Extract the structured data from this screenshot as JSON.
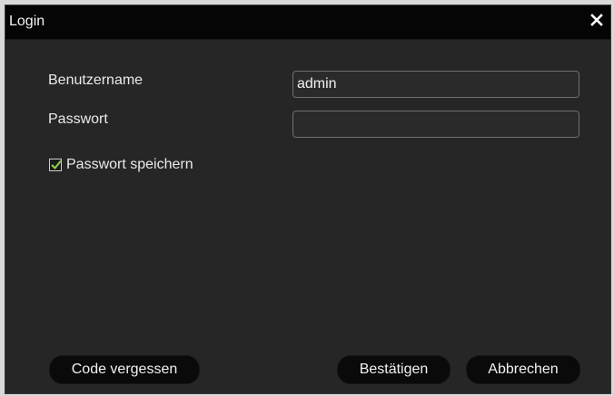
{
  "window": {
    "title": "Login",
    "close_icon": "close-icon"
  },
  "form": {
    "username_label": "Benutzername",
    "username_value": "admin",
    "password_label": "Passwort",
    "password_value": "",
    "remember_label": "Passwort speichern",
    "remember_checked": true
  },
  "buttons": {
    "forgot_label": "Code vergessen",
    "confirm_label": "Bestätigen",
    "cancel_label": "Abbrechen"
  },
  "colors": {
    "dialog_background": "#262626",
    "titlebar_background": "#050505",
    "checkmark": "#8fd14f",
    "text": "#f2f2f2"
  }
}
